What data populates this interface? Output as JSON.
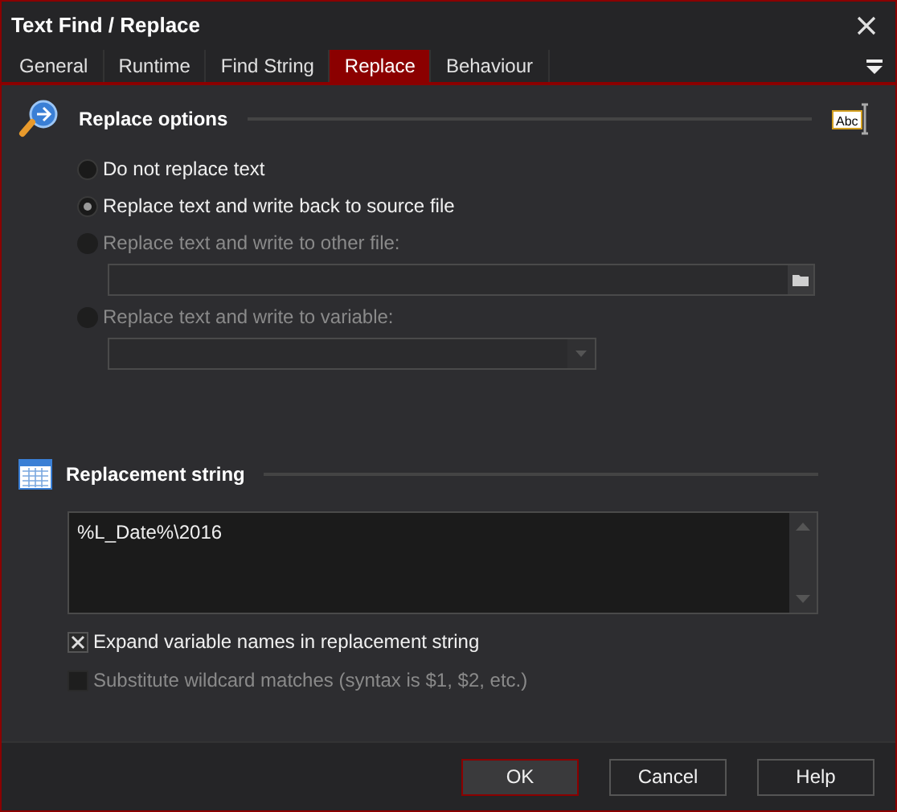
{
  "window": {
    "title": "Text Find / Replace"
  },
  "tabs": [
    {
      "label": "General",
      "selected": false
    },
    {
      "label": "Runtime",
      "selected": false
    },
    {
      "label": "Find String",
      "selected": false
    },
    {
      "label": "Replace",
      "selected": true
    },
    {
      "label": "Behaviour",
      "selected": false
    }
  ],
  "replace_options": {
    "heading": "Replace options",
    "icon_text": "Abc",
    "options": [
      {
        "label": "Do not replace text",
        "selected": false,
        "disabled": false
      },
      {
        "label": "Replace text and write back to source file",
        "selected": true,
        "disabled": false
      },
      {
        "label": "Replace text and write to other file:",
        "selected": false,
        "disabled": true,
        "kind": "file"
      },
      {
        "label": "Replace text and write to variable:",
        "selected": false,
        "disabled": true,
        "kind": "dropdown"
      }
    ]
  },
  "replacement_string": {
    "heading": "Replacement string",
    "value": "%L_Date%\\2016",
    "checkboxes": [
      {
        "label": "Expand variable names in replacement string",
        "checked": true,
        "disabled": false
      },
      {
        "label": "Substitute wildcard matches (syntax is $1, $2, etc.)",
        "checked": false,
        "disabled": true
      }
    ]
  },
  "buttons": [
    {
      "label": "OK",
      "selected": true
    },
    {
      "label": "Cancel",
      "selected": false
    },
    {
      "label": "Help",
      "selected": false
    }
  ]
}
